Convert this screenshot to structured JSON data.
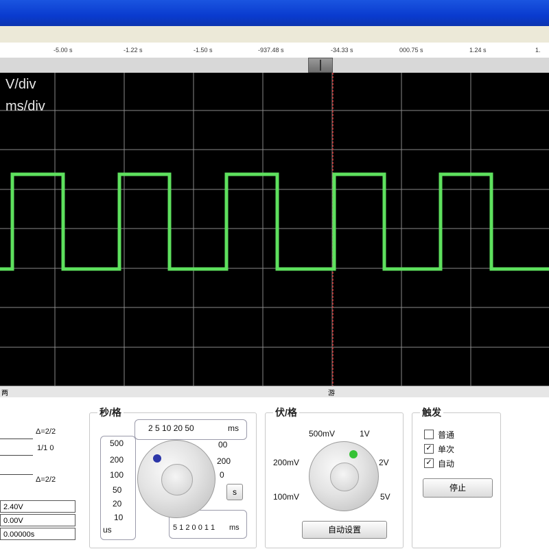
{
  "ruler": {
    "ticks": [
      "-5.00 s",
      "-1.22 s",
      "-1.50 s",
      "-937.48 s",
      "-34.33 s",
      "000.75 s",
      "1.24 s",
      "1."
    ]
  },
  "scope": {
    "volts_label": "V/div",
    "time_label": "ms/div",
    "trace_color": "#5ee05e",
    "grid_color": "#8a8a8a",
    "cursor_color": "#d03030"
  },
  "bottom_strip": {
    "left_text": "两",
    "center_text": "游"
  },
  "left_panel": {
    "top_label": "Δ=2/2",
    "mid_value": "1/1 0",
    "low_label": "Δ=2/2",
    "readouts": [
      "2.40V",
      "0.00V",
      "0.00000s"
    ]
  },
  "timebase": {
    "title": "秒/格",
    "top_scale": "2  5  10  20  50",
    "top_unit": "ms",
    "left_scale": [
      "500",
      "200",
      "100",
      "50",
      "20",
      "10"
    ],
    "left_unit": "us",
    "right_scale": [
      "00",
      "200",
      "0"
    ],
    "bottom_scale": "5  1  2  0  0  1  1",
    "bottom_unit": "ms",
    "step_button": "s"
  },
  "voltage": {
    "title": "伏/格",
    "labels": [
      "500mV",
      "1V",
      "200mV",
      "2V",
      "100mV",
      "5V"
    ],
    "auto_button": "自动设置"
  },
  "trigger": {
    "title": "触发",
    "options": [
      {
        "label": "普通",
        "checked": false
      },
      {
        "label": "单次",
        "checked": true
      },
      {
        "label": "自动",
        "checked": true
      }
    ],
    "check_glyph": "✓",
    "stop_button": "停止"
  }
}
